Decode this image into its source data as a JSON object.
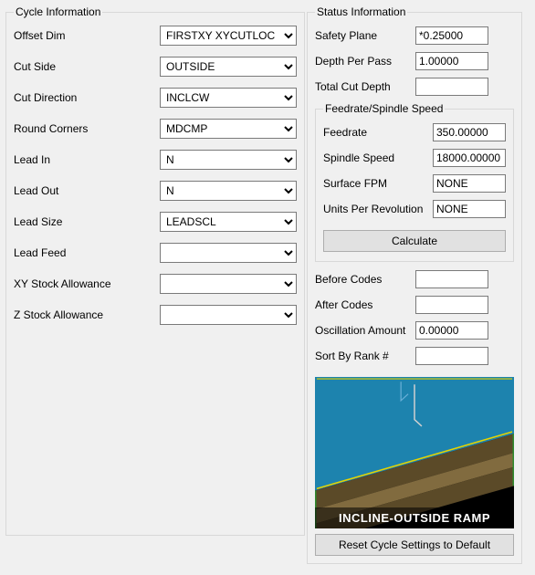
{
  "cycle": {
    "legend": "Cycle Information",
    "offset_dim": {
      "label": "Offset Dim",
      "value": "FIRSTXY XYCUTLOC"
    },
    "cut_side": {
      "label": "Cut Side",
      "value": "OUTSIDE"
    },
    "cut_direction": {
      "label": "Cut Direction",
      "value": "INCLCW"
    },
    "round_corners": {
      "label": "Round Corners",
      "value": "MDCMP"
    },
    "lead_in": {
      "label": "Lead In",
      "value": "N"
    },
    "lead_out": {
      "label": "Lead Out",
      "value": "N"
    },
    "lead_size": {
      "label": "Lead Size",
      "value": "LEADSCL"
    },
    "lead_feed": {
      "label": "Lead Feed",
      "value": ""
    },
    "xy_stock": {
      "label": "XY Stock Allowance",
      "value": ""
    },
    "z_stock": {
      "label": "Z Stock Allowance",
      "value": ""
    }
  },
  "status": {
    "legend": "Status Information",
    "safety_plane": {
      "label": "Safety Plane",
      "value": "*0.25000"
    },
    "depth_per_pass": {
      "label": "Depth Per Pass",
      "value": "1.00000"
    },
    "total_cut_depth": {
      "label": "Total Cut Depth",
      "value": ""
    },
    "feed_speed": {
      "legend": "Feedrate/Spindle Speed",
      "feedrate": {
        "label": "Feedrate",
        "value": "350.00000"
      },
      "spindle_speed": {
        "label": "Spindle Speed",
        "value": "18000.00000"
      },
      "surface_fpm": {
        "label": "Surface FPM",
        "value": "NONE"
      },
      "units_per_rev": {
        "label": "Units Per Revolution",
        "value": "NONE"
      },
      "calculate_label": "Calculate"
    },
    "before_codes": {
      "label": "Before Codes",
      "value": ""
    },
    "after_codes": {
      "label": "After Codes",
      "value": ""
    },
    "oscillation": {
      "label": "Oscillation Amount",
      "value": "0.00000"
    },
    "sort_rank": {
      "label": "Sort By Rank #",
      "value": ""
    },
    "illustration_caption": "INCLINE-OUTSIDE RAMP",
    "reset_label": "Reset Cycle Settings to Default"
  }
}
